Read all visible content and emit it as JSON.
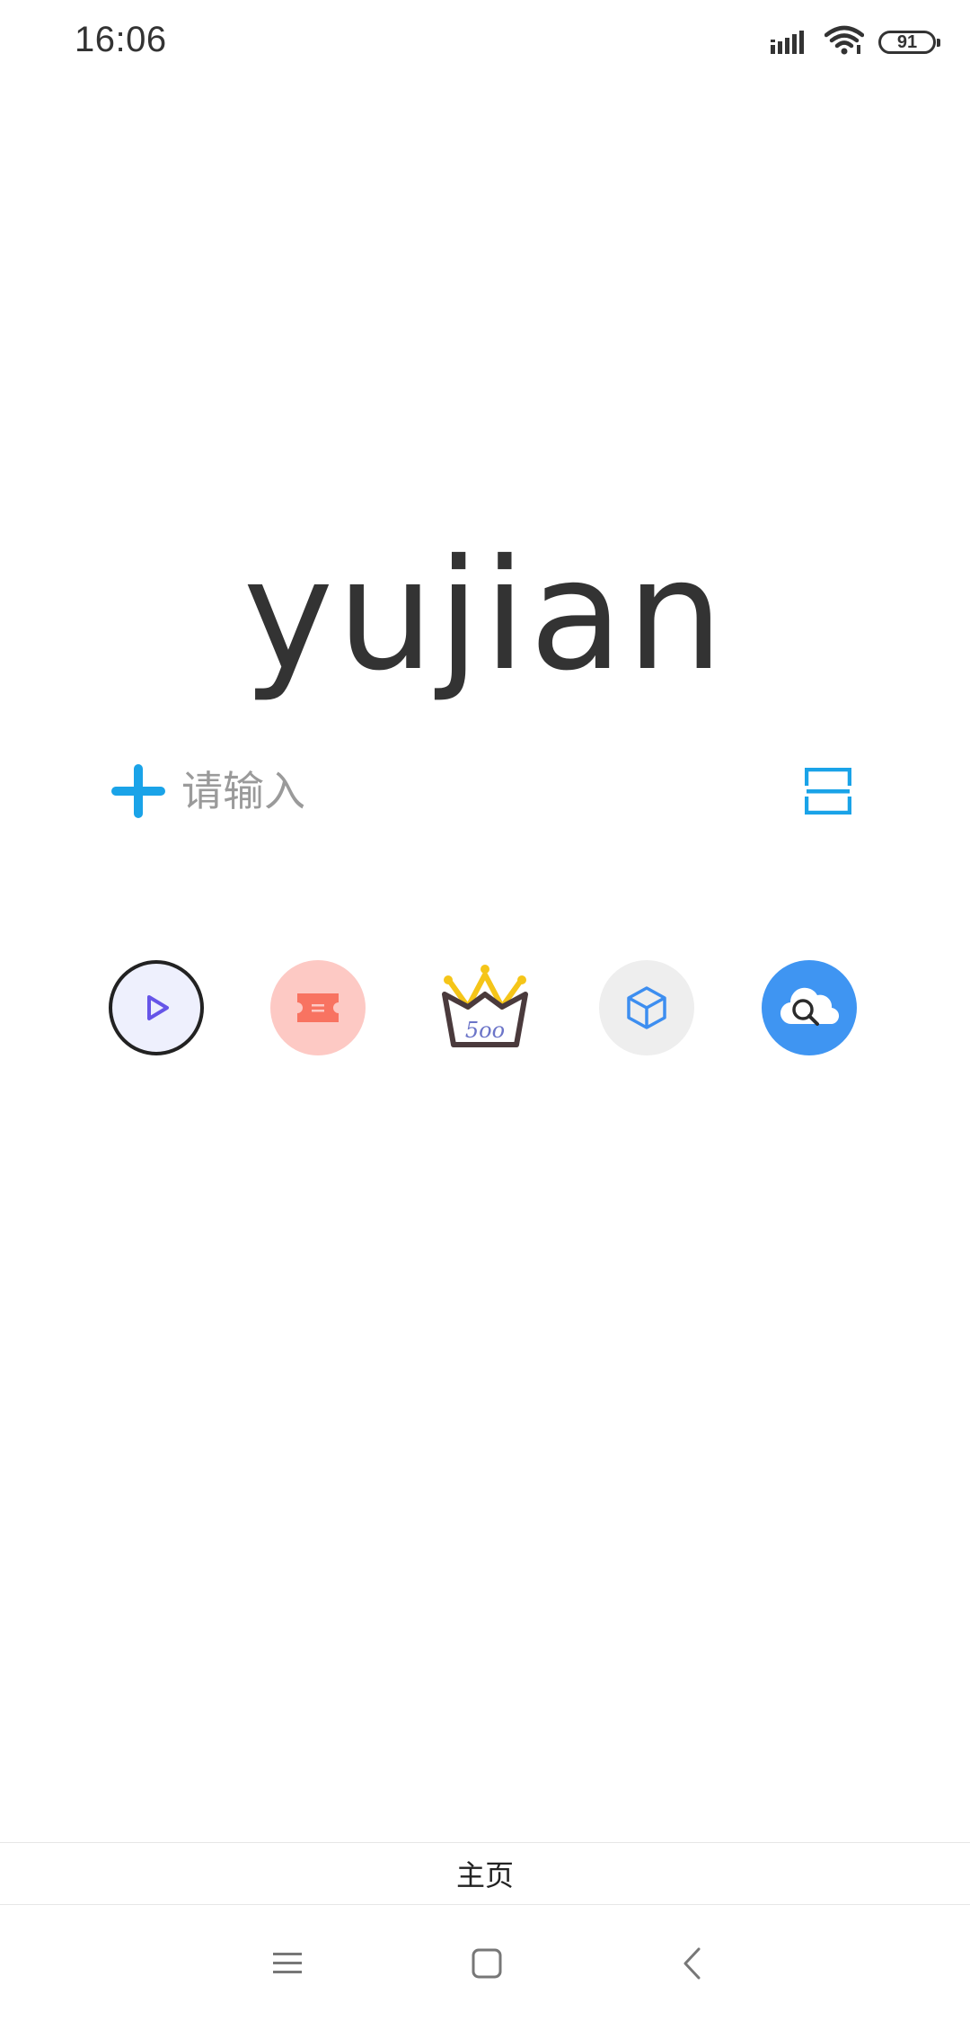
{
  "status_bar": {
    "time": "16:06",
    "battery_level": "91",
    "icons": [
      "signal-icon",
      "wifi-icon",
      "battery-icon"
    ]
  },
  "logo": {
    "text": "yujian"
  },
  "search": {
    "placeholder": "请输入",
    "value": "",
    "add_icon": "plus-icon",
    "scan_icon": "scan-icon"
  },
  "shortcuts": [
    {
      "name": "video",
      "icon": "play-icon"
    },
    {
      "name": "ticket",
      "icon": "ticket-icon"
    },
    {
      "name": "crown-basket",
      "icon": "crown-basket-icon"
    },
    {
      "name": "box",
      "icon": "cube-icon"
    },
    {
      "name": "cloud-search",
      "icon": "cloud-search-icon"
    }
  ],
  "tab_bar": {
    "home_label": "主页"
  },
  "nav_bar": {
    "icons": [
      "menu-icon",
      "home-square-icon",
      "back-icon"
    ]
  },
  "colors": {
    "accent": "#1aa3e8",
    "text": "#333333",
    "placeholder": "#9a9a9a",
    "ticket_bg": "#fdc9c4",
    "ticket_fg": "#f87361",
    "play_bg": "#eef0fd",
    "play_fg": "#6655e8",
    "cube_bg": "#eeeeee",
    "cube_fg": "#3d8ef0",
    "cloud_bg": "#3f95f2",
    "crown_gold": "#f5c518"
  }
}
